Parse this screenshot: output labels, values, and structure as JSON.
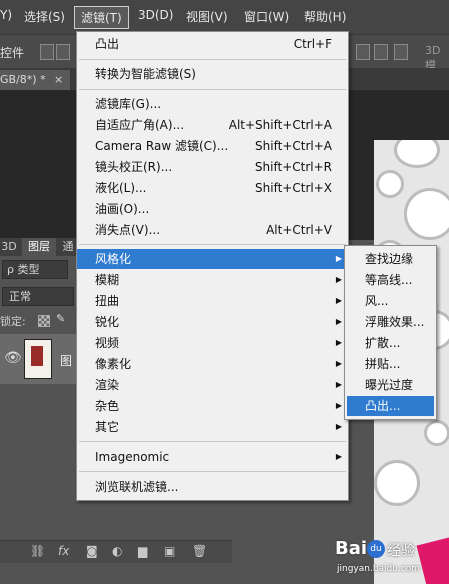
{
  "menubar": {
    "items": [
      "Y)",
      "选择(S)",
      "滤镜(T)",
      "3D(D)",
      "视图(V)",
      "窗口(W)",
      "帮助(H)"
    ],
    "active_index": 2
  },
  "options_bar": {
    "left_label": "控件",
    "right_label": "3D 模"
  },
  "doc_tab": {
    "label": "GB/8*) *",
    "close": "×"
  },
  "layers_panel": {
    "tabs": [
      "3D",
      "图层",
      "通"
    ],
    "kind_label": "ρ 类型",
    "blend_mode": "正常",
    "lock_label": "锁定:",
    "layer_name": "图",
    "bottom_icons": [
      "link-icon",
      "fx-icon",
      "mask-icon",
      "adjustment-icon",
      "folder-icon",
      "new-layer-icon",
      "trash-icon"
    ]
  },
  "filter_menu": {
    "items": [
      {
        "label": "凸出",
        "shortcut": "Ctrl+F"
      },
      {
        "label": "转换为智能滤镜(S)"
      },
      {
        "label": "滤镜库(G)..."
      },
      {
        "label": "自适应广角(A)...",
        "shortcut": "Alt+Shift+Ctrl+A"
      },
      {
        "label": "Camera Raw 滤镜(C)...",
        "shortcut": "Shift+Ctrl+A"
      },
      {
        "label": "镜头校正(R)...",
        "shortcut": "Shift+Ctrl+R"
      },
      {
        "label": "液化(L)...",
        "shortcut": "Shift+Ctrl+X"
      },
      {
        "label": "油画(O)..."
      },
      {
        "label": "消失点(V)...",
        "shortcut": "Alt+Ctrl+V"
      },
      {
        "label": "风格化",
        "submenu": true,
        "highlighted": true
      },
      {
        "label": "模糊",
        "submenu": true
      },
      {
        "label": "扭曲",
        "submenu": true
      },
      {
        "label": "锐化",
        "submenu": true
      },
      {
        "label": "视频",
        "submenu": true
      },
      {
        "label": "像素化",
        "submenu": true
      },
      {
        "label": "渲染",
        "submenu": true
      },
      {
        "label": "杂色",
        "submenu": true
      },
      {
        "label": "其它",
        "submenu": true
      },
      {
        "label": "Imagenomic",
        "submenu": true
      },
      {
        "label": "浏览联机滤镜..."
      }
    ]
  },
  "stylize_submenu": {
    "items": [
      "查找边缘",
      "等高线...",
      "风...",
      "浮雕效果...",
      "扩散...",
      "拼贴...",
      "曝光过度",
      "凸出..."
    ],
    "highlighted_index": 7
  },
  "watermark": {
    "brand": "Bai",
    "logo_glyph": "du",
    "tagline": "经验",
    "url": "jingyan.baidu.com"
  },
  "colors": {
    "highlight": "#2e7bd0",
    "menu_bg": "#f0f0f0",
    "app_bg": "#535353"
  }
}
